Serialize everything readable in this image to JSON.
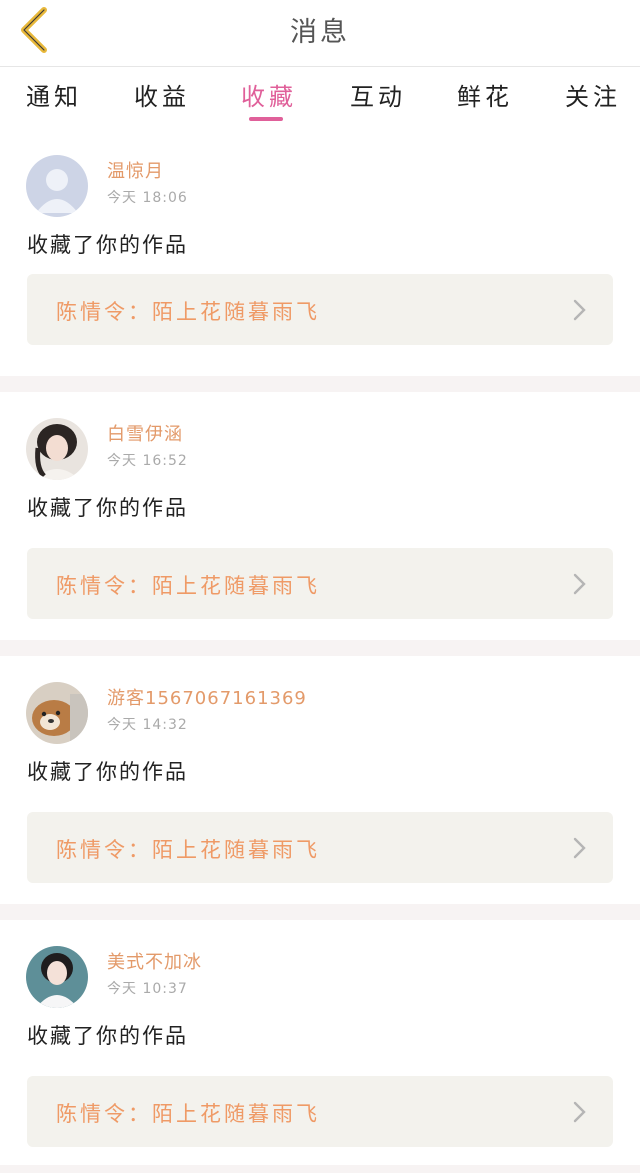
{
  "header": {
    "title": "消息"
  },
  "tabs": [
    {
      "label": "通知",
      "active": false
    },
    {
      "label": "收益",
      "active": false
    },
    {
      "label": "收藏",
      "active": true
    },
    {
      "label": "互动",
      "active": false
    },
    {
      "label": "鲜花",
      "active": false
    },
    {
      "label": "关注",
      "active": false
    }
  ],
  "items": [
    {
      "name": "温惊月",
      "time": "今天 18:06",
      "message": "收藏了你的作品",
      "work": "陈情令：陌上花随暮雨飞",
      "avatar": "default-avatar-icon"
    },
    {
      "name": "白雪伊涵",
      "time": "今天 16:52",
      "message": "收藏了你的作品",
      "work": "陈情令：陌上花随暮雨飞",
      "avatar": "user-photo"
    },
    {
      "name": "游客1567067161369",
      "time": "今天 14:32",
      "message": "收藏了你的作品",
      "work": "陈情令：陌上花随暮雨飞",
      "avatar": "dog-photo"
    },
    {
      "name": "美式不加冰",
      "time": "今天 10:37",
      "message": "收藏了你的作品",
      "work": "陈情令：陌上花随暮雨飞",
      "avatar": "user-photo"
    }
  ],
  "colors": {
    "accent": "#e0609a",
    "name": "#e39a6a",
    "work": "#ef9a66",
    "back_icon": "#e8b83a"
  }
}
